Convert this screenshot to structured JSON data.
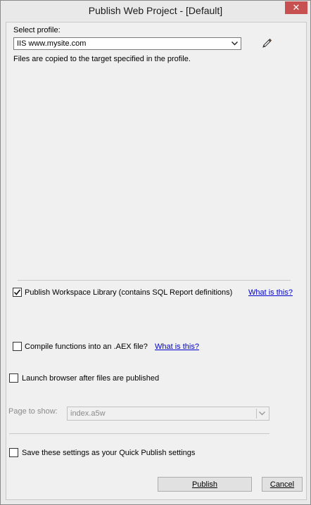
{
  "window": {
    "title": "Publish Web Project - [Default]",
    "close_glyph": "✕"
  },
  "profile": {
    "label": "Select profile:",
    "selected": "IIS www.mysite.com",
    "description": "Files are copied to the target specified in the profile.",
    "edit_icon": "pencil-edit-icon"
  },
  "options": {
    "publish_workspace": {
      "label": "Publish Workspace Library (contains SQL Report definitions)",
      "checked": true,
      "link": "What is this?"
    },
    "compile_aex": {
      "label": "Compile functions into an .AEX file?",
      "checked": false,
      "link": "What is this?"
    },
    "launch_browser": {
      "label": "Launch browser after files are published",
      "checked": false
    },
    "page_to_show": {
      "label": "Page to show:",
      "value": "index.a5w",
      "disabled": true
    },
    "save_quick_publish": {
      "label": "Save these settings as your Quick Publish settings",
      "checked": false
    }
  },
  "buttons": {
    "publish": "Publish",
    "cancel": "Cancel"
  },
  "colors": {
    "link": "#0000cc",
    "close_button": "#c75050"
  }
}
